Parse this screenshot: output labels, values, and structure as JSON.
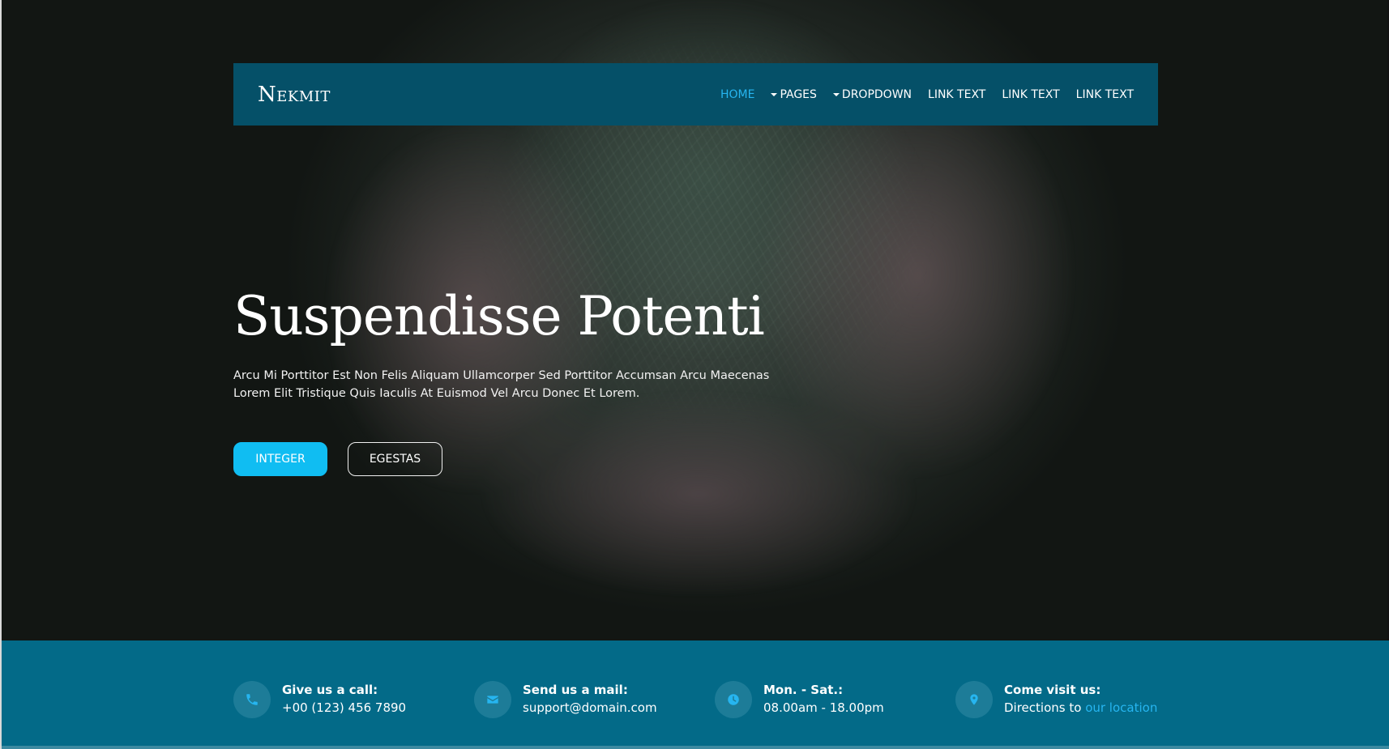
{
  "brand": {
    "name": "Nekmit"
  },
  "nav": {
    "items": [
      {
        "label": "HOME",
        "active": true,
        "dropdown": false
      },
      {
        "label": "PAGES",
        "active": false,
        "dropdown": true
      },
      {
        "label": "DROPDOWN",
        "active": false,
        "dropdown": true
      },
      {
        "label": "LINK TEXT",
        "active": false,
        "dropdown": false
      },
      {
        "label": "LINK TEXT",
        "active": false,
        "dropdown": false
      },
      {
        "label": "LINK TEXT",
        "active": false,
        "dropdown": false
      }
    ]
  },
  "hero": {
    "title": "Suspendisse Potenti",
    "text_line1": "Arcu Mi Porttitor Est Non Felis Aliquam Ullamcorper Sed Porttitor Accumsan Arcu Maecenas",
    "text_line2": "Lorem Elit Tristique Quis Iaculis At Euismod Vel Arcu Donec Et Lorem.",
    "primary_button": "INTEGER",
    "secondary_button": "EGESTAS"
  },
  "contact": {
    "call": {
      "icon": "phone-icon",
      "label": "Give us a call:",
      "value": "+00 (123) 456 7890"
    },
    "mail": {
      "icon": "mail-icon",
      "label": "Send us a mail:",
      "value": "support@domain.com"
    },
    "hours": {
      "icon": "clock-icon",
      "label": "Mon. - Sat.:",
      "value": "08.00am - 18.00pm"
    },
    "visit": {
      "icon": "map-pin-icon",
      "label": "Come visit us:",
      "value_prefix": "Directions to",
      "link": "our location"
    }
  },
  "colors": {
    "navbar_bg": "#055068",
    "accent": "#10bdf2",
    "active_nav": "#26b5f0",
    "info_bar_bg": "#036a88",
    "icon_circle": "#1d7c98"
  }
}
